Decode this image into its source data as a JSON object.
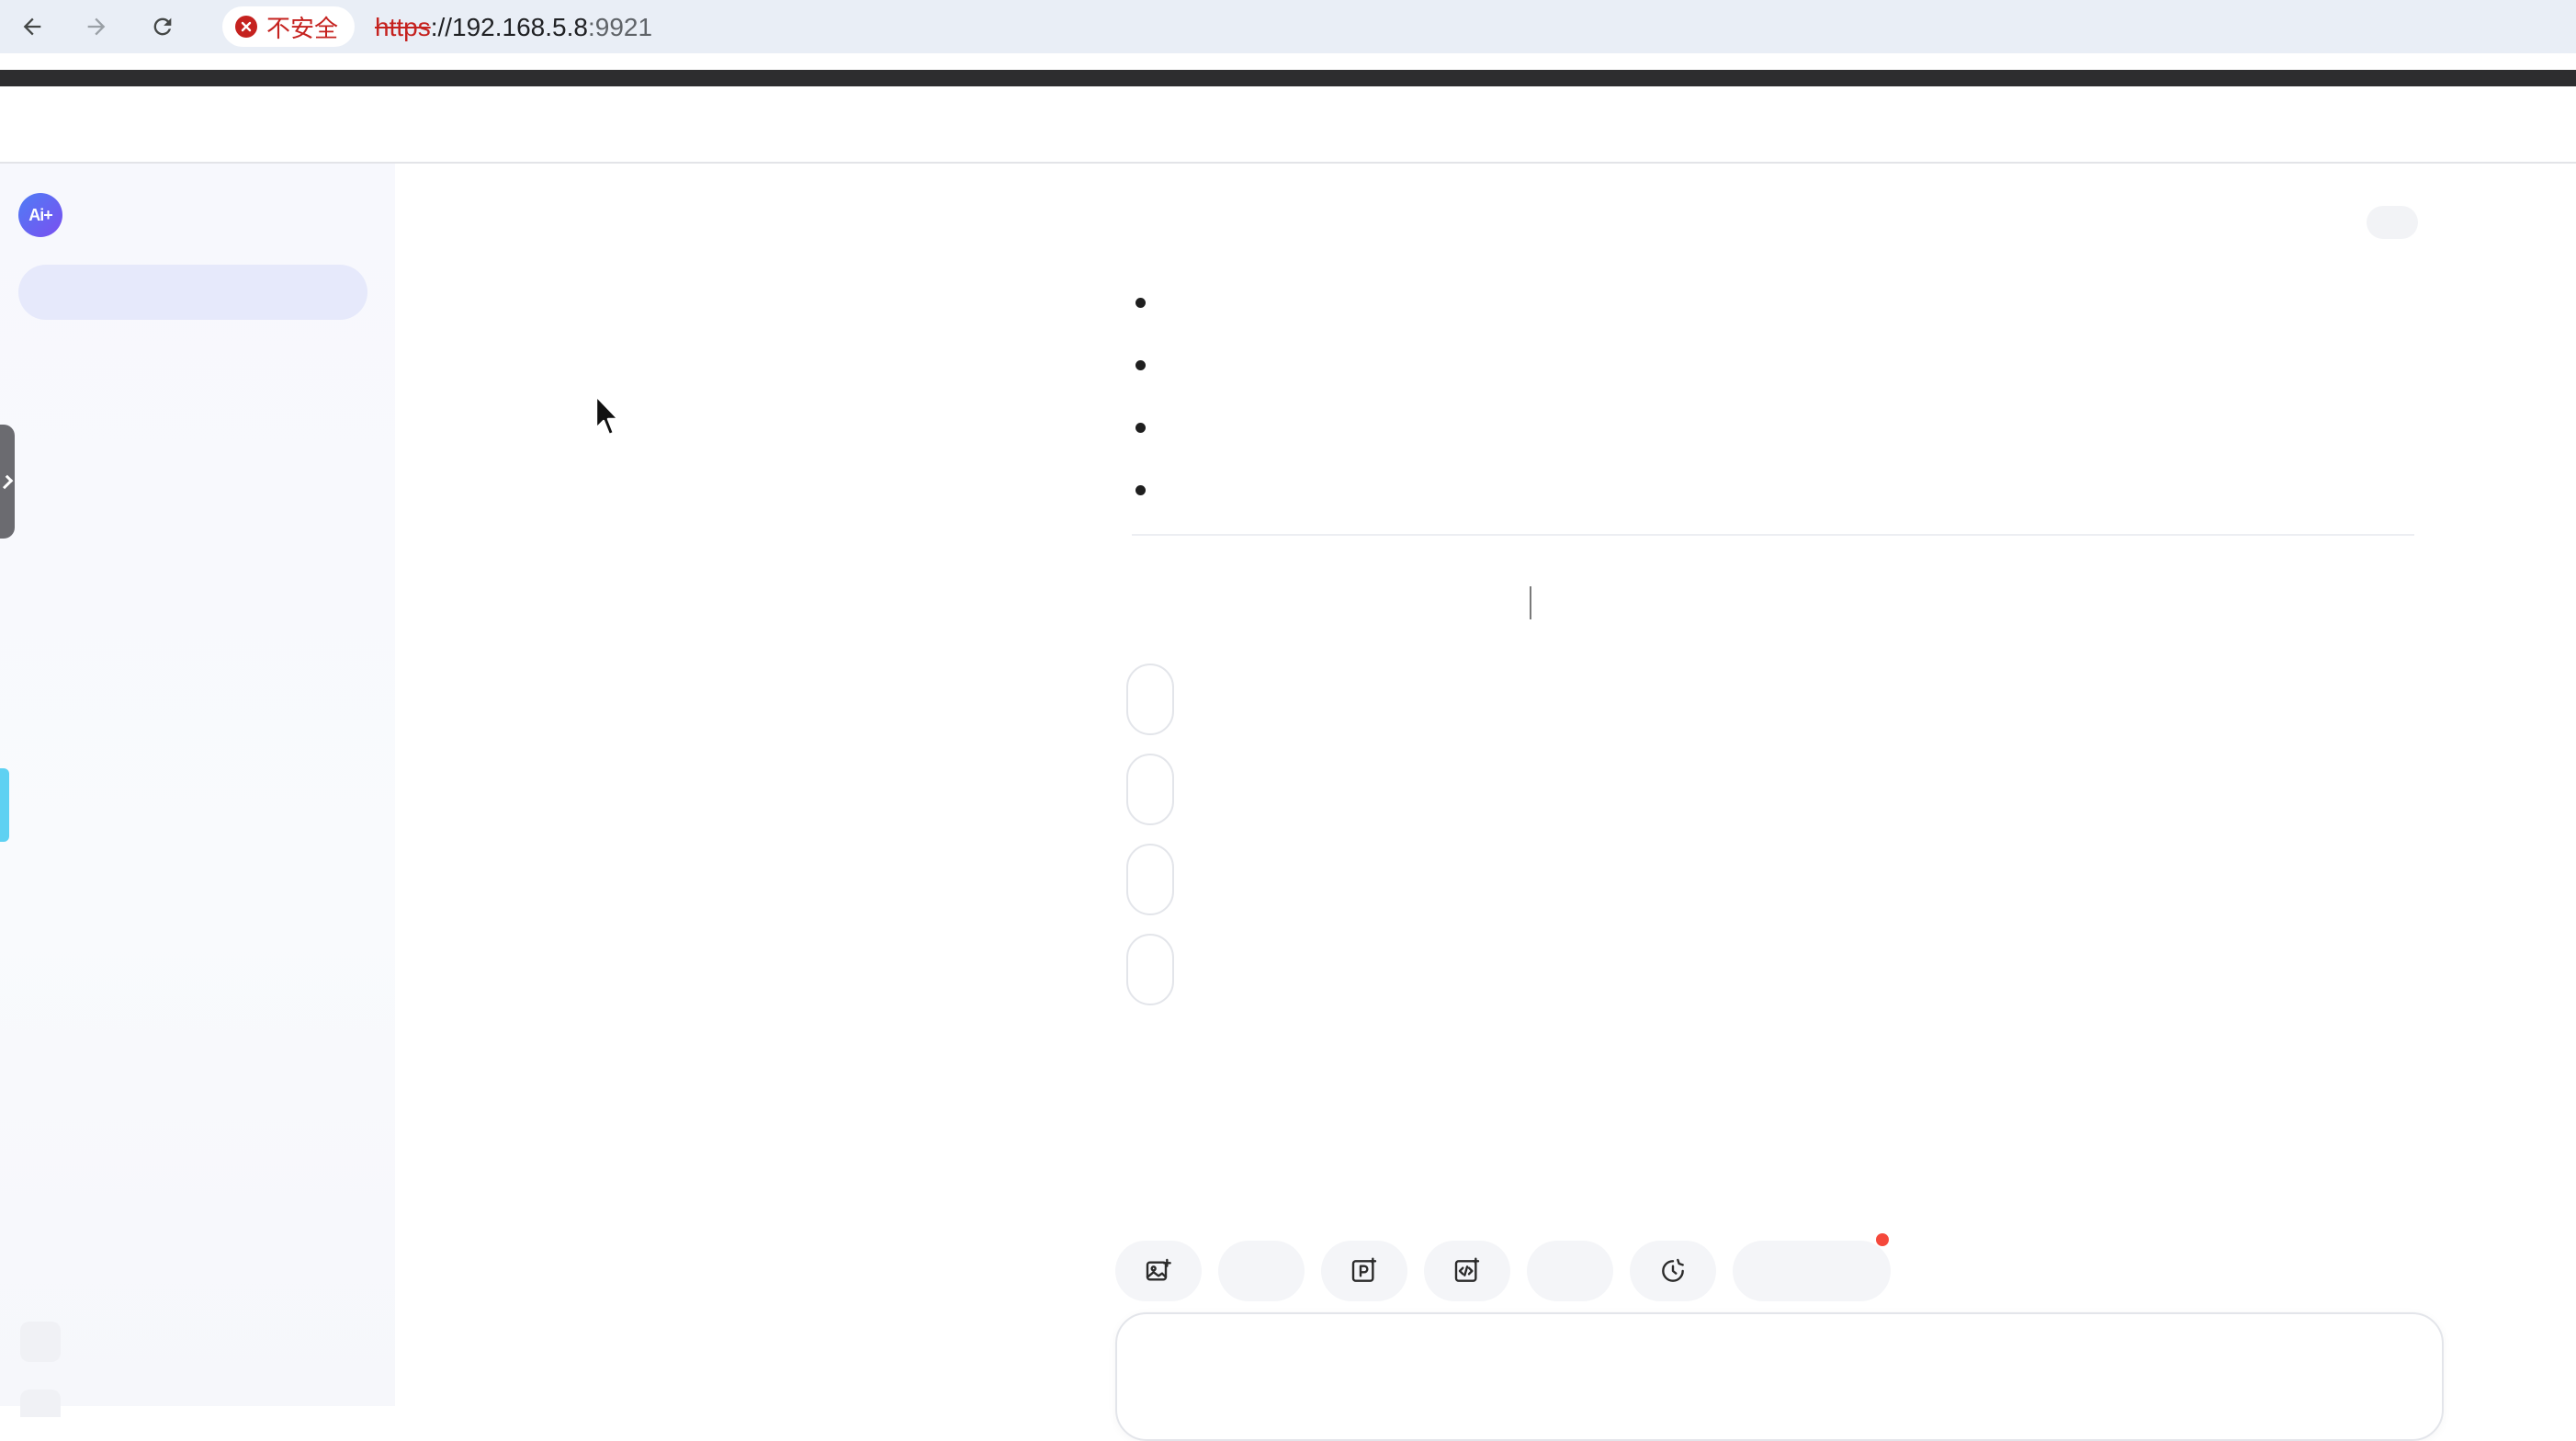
{
  "browser": {
    "security_label": "不安全",
    "url_scheme": "https",
    "url_rest": "://192.168.5.8",
    "url_port": ":9921"
  },
  "sidebar": {
    "logo_text": "Ai+"
  },
  "colors": {
    "accent_blue": "#4f7df5",
    "accent_purple": "#7a4ff0",
    "security_red": "#c5221f",
    "notify_dot": "#f5483b",
    "sidebar_accent": "#5ed1f2"
  },
  "icons": {
    "back": "arrow-left-icon",
    "forward": "arrow-right-icon",
    "reload": "reload-icon",
    "security": "error-x-icon",
    "tool_image": "image-add-icon",
    "tool_ppt": "presentation-add-icon",
    "tool_code": "code-add-icon",
    "tool_timer": "timer-icon"
  }
}
